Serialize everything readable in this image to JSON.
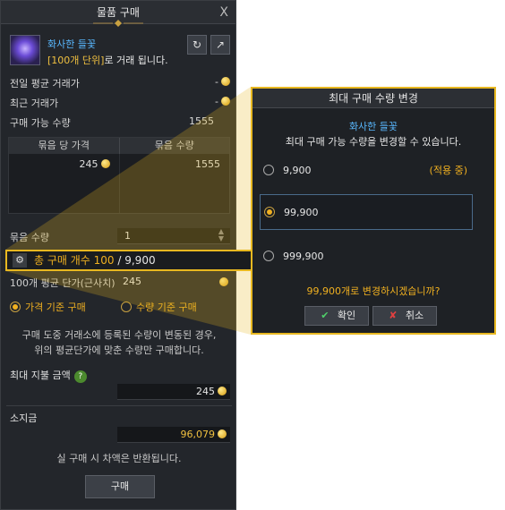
{
  "window": {
    "title": "물품 구매",
    "close": "X"
  },
  "item": {
    "name": "화사한 들꽃",
    "unit_note_highlight": "[100개 단위]",
    "unit_note_rest": "로 거래 됩니다."
  },
  "stats": {
    "prev_avg_label": "전일 평균 거래가",
    "prev_avg_value": "-",
    "recent_label": "최근 거래가",
    "recent_value": "-",
    "available_label": "구매 가능 수량",
    "available_value": "1555"
  },
  "table": {
    "headers": [
      "묶음 당 가격",
      "묶음 수량"
    ],
    "rows": [
      {
        "price": "245",
        "qty": "1555"
      }
    ]
  },
  "bundle": {
    "label": "묶음 수량",
    "value": "1"
  },
  "total": {
    "label": "총 구매 개수 100",
    "max": " / 9,900"
  },
  "avg_price": {
    "label": "100개 평균 단가(근사치)",
    "value": "245"
  },
  "mode": {
    "price_based": "가격 기준 구매",
    "qty_based": "수량 기준 구매",
    "selected": "price_based"
  },
  "notice": [
    "구매 도중 거래소에 등록된 수량이 변동된 경우,",
    "위의 평균단가에 맞춘 수량만 구매합니다."
  ],
  "max_payment": {
    "label": "최대 지불 금액",
    "value": "245"
  },
  "gold": {
    "label": "소지금",
    "value": "96,079"
  },
  "refund_note": "실 구매 시 차액은 반환됩니다.",
  "buy_label": "구매",
  "modal": {
    "title": "최대 구매 수량 변경",
    "item_name": "화사한 들꽃",
    "desc": "최대 구매 가능 수량을 변경할 수 있습니다.",
    "options": [
      {
        "value": "9,900",
        "tag": "(적용 중)"
      },
      {
        "value": "99,900",
        "tag": ""
      },
      {
        "value": "999,900",
        "tag": ""
      }
    ],
    "selected_index": 1,
    "confirm_text": "99,900개로 변경하시겠습니까?",
    "ok_label": "확인",
    "cancel_label": "취소"
  },
  "colors": {
    "accent_gold": "#e8b820",
    "item_blue": "#59b8ff",
    "highlight_orange": "#f0b020"
  }
}
